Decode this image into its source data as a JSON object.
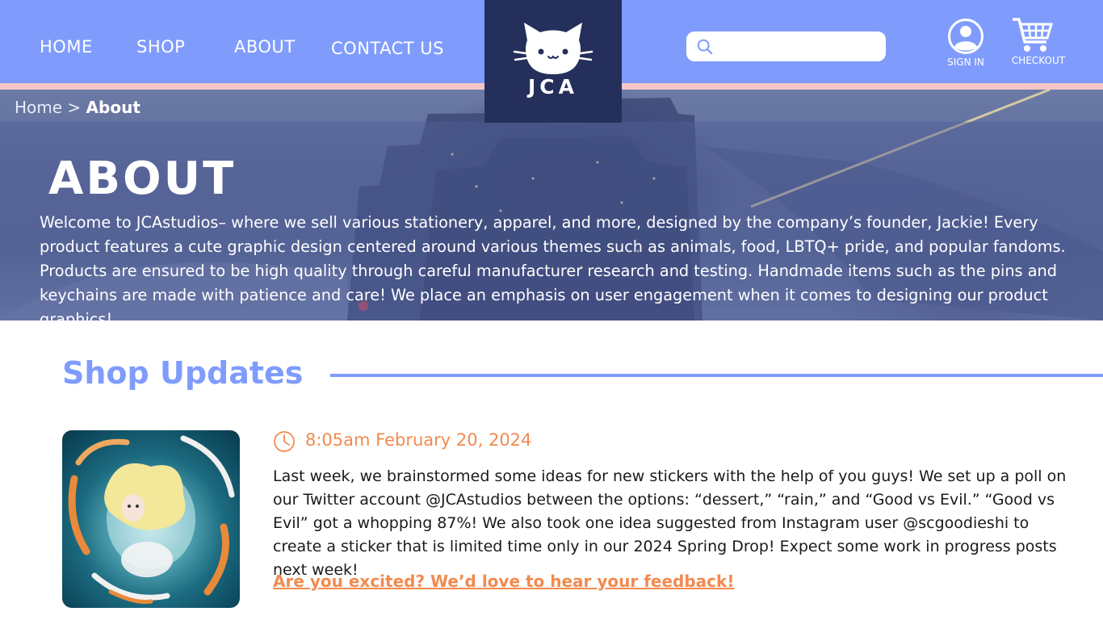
{
  "nav": {
    "links": [
      "HOME",
      "SHOP",
      "ABOUT",
      "CONTACT US"
    ],
    "logo_text": "JCA",
    "search_placeholder": "",
    "account_label": "SIGN IN",
    "cart_label": "CHECKOUT"
  },
  "hero": {
    "breadcrumb_home": "Home",
    "breadcrumb_sep": ">",
    "breadcrumb_current": "About",
    "title": "ABOUT",
    "text": "Welcome to JCAstudios– where we sell various stationery, apparel, and more, designed by the company’s founder, Jackie! Every product features a cute graphic design centered around various themes such as animals, food, LBTQ+ pride, and popular fandoms. Products are ensured to be high quality through careful manufacturer research and testing. Handmade items such as the pins and keychains are made with patience and care! We place an emphasis on user engagement when it comes to designing our product graphics!"
  },
  "updates": {
    "section_title": "Shop Updates",
    "post": {
      "time": "8:05am February 20, 2024",
      "body": "Last week, we brainstormed some ideas for new stickers with the help of you guys! We set up a poll on our Twitter account @JCAstudios between the options: “dessert,” “rain,” and “Good vs Evil.” “Good vs Evil” got a whopping 87%! We also took one idea suggested from Instagram user @scgoodieshi to create a sticker that is limited time only in our 2024 Spring Drop! Expect some work in progress posts next week!",
      "link": "Are you excited? We’d love to hear your feedback!"
    }
  },
  "colors": {
    "nav_bg": "#7f9cfd",
    "stripe": "#f4c6c6",
    "logo_bg": "#252f5c",
    "accent_orange": "#f28a4f",
    "section_blue": "#7f9cfd"
  }
}
